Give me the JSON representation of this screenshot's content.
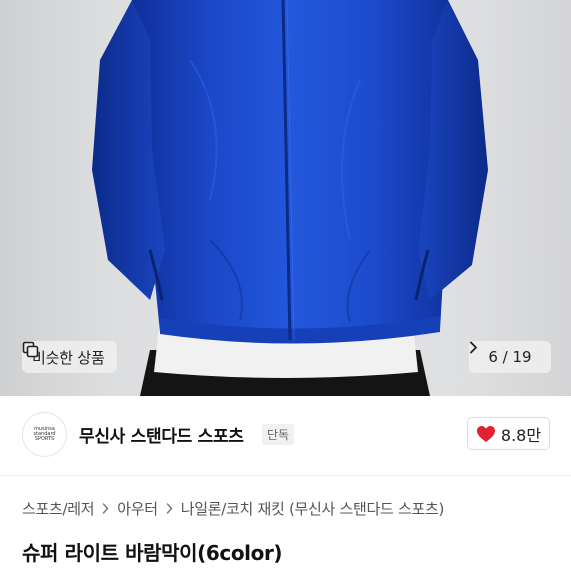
{
  "gallery": {
    "similar_label": "비슷한 상품",
    "similar_icon": "copy-icon",
    "pager_text": "6 / 19",
    "current_page": 6,
    "total_pages": 19,
    "pager_icon": "chevron-right-icon"
  },
  "brand": {
    "logo_lines": [
      "musinsa",
      "standard",
      "SPORTS"
    ],
    "name": "무신사 스탠다드 스포츠",
    "badge": "단독"
  },
  "like": {
    "icon": "heart-icon",
    "count": "8.8만",
    "color": "#e0242f"
  },
  "breadcrumb": [
    "스포츠/레저",
    "아우터",
    "나일론/코치 재킷 (무신사 스탠다드 스포츠)"
  ],
  "product": {
    "title": "슈퍼 라이트 바람막이(6color)"
  },
  "colors": {
    "jacket_blue": "#1f50d6"
  }
}
